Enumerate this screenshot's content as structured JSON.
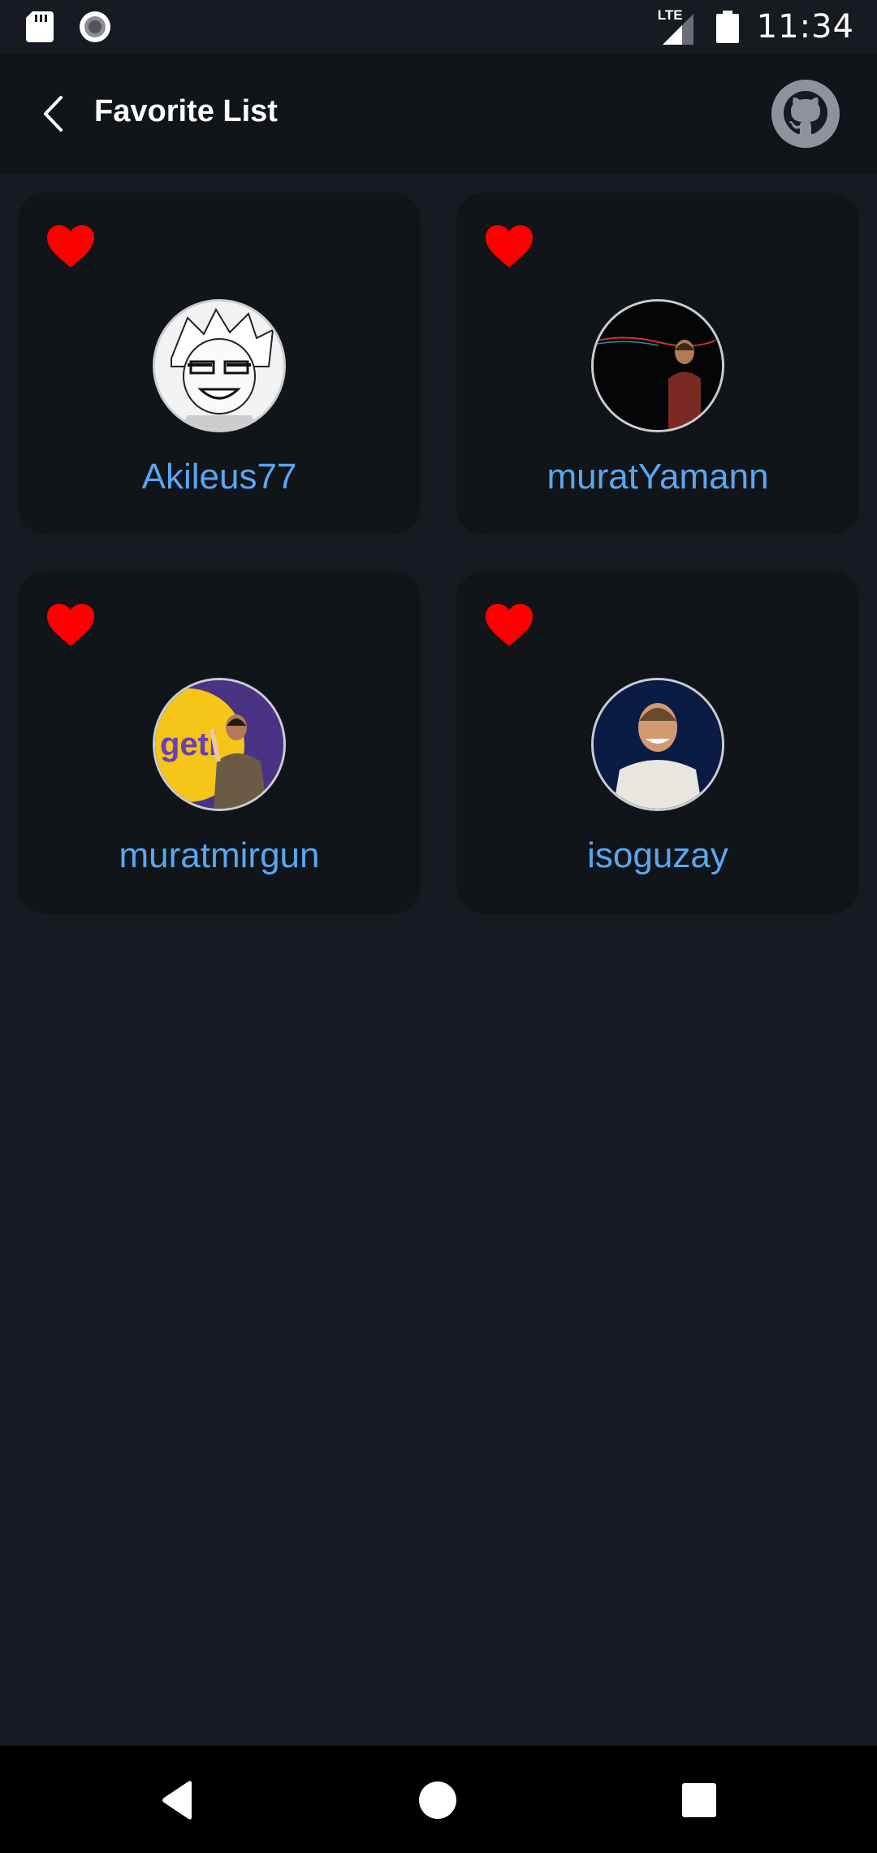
{
  "status_bar": {
    "time": "11:34",
    "network": "LTE",
    "icons": [
      "sd-card-icon",
      "record-icon",
      "signal-icon",
      "battery-icon"
    ]
  },
  "app_bar": {
    "title": "Favorite List",
    "back_icon": "chevron-left-icon",
    "profile_icon": "github-icon"
  },
  "favorites": [
    {
      "username": "Akileus77",
      "favorited": true
    },
    {
      "username": "muratYamann",
      "favorited": true
    },
    {
      "username": "muratmirgun",
      "favorited": true
    },
    {
      "username": "isoguzay",
      "favorited": true
    }
  ],
  "colors": {
    "background": "#171a21",
    "card": "#111419",
    "username": "#5aa7f0",
    "heart": "#ff0000"
  },
  "nav_bar": {
    "icons": [
      "back-triangle-icon",
      "home-circle-icon",
      "recents-square-icon"
    ]
  }
}
